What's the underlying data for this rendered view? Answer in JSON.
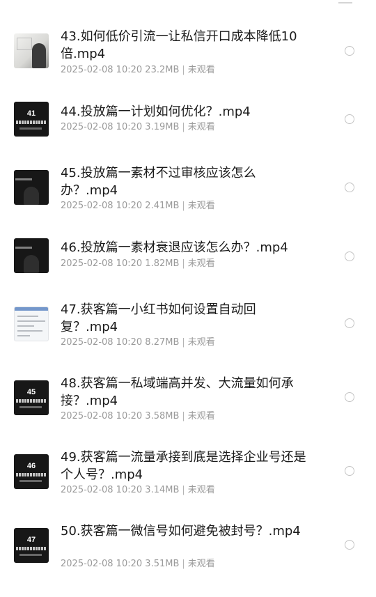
{
  "items": [
    {
      "title": "43.如何低价引流一让私信开口成本降低10倍.mp4",
      "date": "2025-02-08 10:20",
      "size": "23.2MB",
      "status": "未观看",
      "thumb_label": ""
    },
    {
      "title": "44.投放篇一计划如何优化？.mp4",
      "date": "2025-02-08 10:20",
      "size": "3.19MB",
      "status": "未观看",
      "thumb_label": "41"
    },
    {
      "title": "45.投放篇一素材不过审核应该怎么办？.mp4",
      "date": "2025-02-08 10:20",
      "size": "2.41MB",
      "status": "未观看",
      "thumb_label": ""
    },
    {
      "title": "46.投放篇一素材衰退应该怎么办？.mp4",
      "date": "2025-02-08 10:20",
      "size": "1.82MB",
      "status": "未观看",
      "thumb_label": ""
    },
    {
      "title": "47.获客篇一小红书如何设置自动回复？.mp4",
      "date": "2025-02-08 10:20",
      "size": "8.27MB",
      "status": "未观看",
      "thumb_label": ""
    },
    {
      "title": "48.获客篇一私域端高并发、大流量如何承接？.mp4",
      "date": "2025-02-08 10:20",
      "size": "3.58MB",
      "status": "未观看",
      "thumb_label": "45"
    },
    {
      "title": "49.获客篇一流量承接到底是选择企业号还是个人号？.mp4",
      "date": "2025-02-08 10:20",
      "size": "3.14MB",
      "status": "未观看",
      "thumb_label": "46"
    },
    {
      "title": "50.获客篇一微信号如何避免被封号？.mp4",
      "date": "2025-02-08 10:20",
      "size": "3.51MB",
      "status": "未观看",
      "thumb_label": "47"
    }
  ]
}
